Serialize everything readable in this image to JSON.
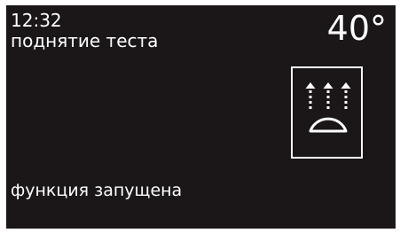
{
  "header": {
    "time": "12:32",
    "program_name": "поднятие теста"
  },
  "temperature": {
    "value": "40°"
  },
  "mode_tile": {
    "icon": "dough-rising-icon",
    "color": "#ffffff"
  },
  "status": {
    "text": "функция запущена"
  },
  "colors": {
    "background": "#1b1718",
    "foreground": "#ffffff",
    "frame": "#ffffff"
  }
}
